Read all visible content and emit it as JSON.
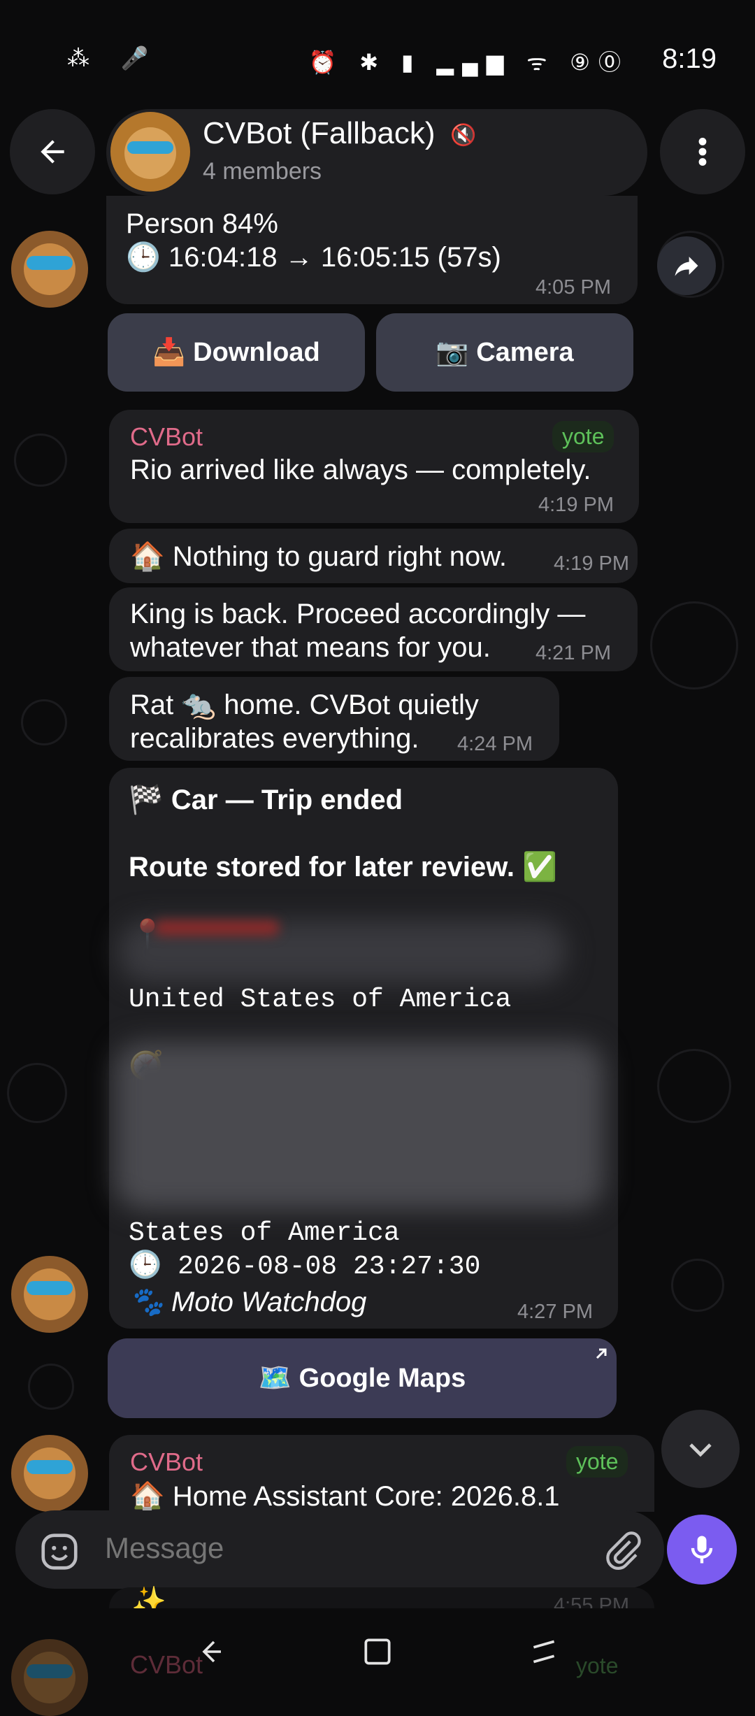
{
  "status": {
    "time": "8:19",
    "left_icons": "⁂ 🎤",
    "right_icons": "⏰ ✱ ▮ ▂▄▆ ᯤ ⑨⓪"
  },
  "header": {
    "title": "CVBot (Fallback)",
    "subtitle": "4 members",
    "back_icon": "arrow-left-icon",
    "menu_icon": "more-vertical-icon",
    "mute_icon": "🔇"
  },
  "messages": {
    "m1": {
      "line1": "Person 84%",
      "line2": "🕒 16:04:18 → 16:05:15 (57s)",
      "time": "4:05 PM"
    },
    "buttons1": {
      "download": "📥 Download",
      "camera": "📷 Camera"
    },
    "m2": {
      "sender": "CVBot",
      "badge": "yote",
      "text": "Rio arrived like always — completely.",
      "time": "4:19 PM"
    },
    "m3": {
      "text": "🏠 Nothing to guard right now.",
      "time": "4:19 PM"
    },
    "m4": {
      "line1": "King is back. Proceed accordingly —",
      "line2": "whatever that means for you.",
      "time": "4:21 PM"
    },
    "m5": {
      "line1": "Rat 🐀 home. CVBot quietly",
      "line2": "recalibrates everything.",
      "time": "4:24 PM"
    },
    "m6": {
      "title": "🏁 Car — Trip ended",
      "subtitle": "Route stored for later review. ✅",
      "pin": "📍",
      "country": "United States of America",
      "compass": "🧭",
      "country2": "States of America",
      "datetime": "🕒 2026-08-08 23:27:30",
      "footer_icon": "🐾",
      "footer": "Moto Watchdog",
      "time": "4:27 PM"
    },
    "maps_button": "🗺️ Google Maps",
    "m7": {
      "sender": "CVBot",
      "badge": "yote",
      "text": "🏠 Home Assistant Core: 2026.8.1"
    },
    "m8": {
      "sparkle": "✨",
      "time": "4:55 PM",
      "sender": "CVBot",
      "badge": "yote"
    }
  },
  "composer": {
    "placeholder": "Message",
    "emoji_icon": "sticker-icon",
    "attach_icon": "paperclip-icon",
    "mic_icon": "microphone-icon"
  },
  "colors": {
    "accent": "#7b5cf0",
    "sender": "#e06b8a",
    "badge": "#5ec15a",
    "bubble": "#1f1f22",
    "button": "#3b3d4a"
  }
}
